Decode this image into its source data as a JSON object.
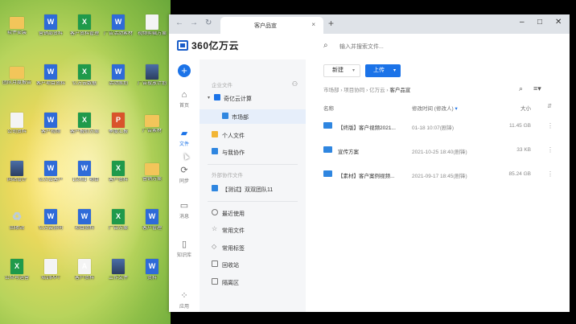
{
  "desktop": {
    "icons": [
      {
        "label": "软件安装",
        "type": "folder",
        "col": 0,
        "row": 0
      },
      {
        "label": "营销部资料",
        "type": "word",
        "col": 1,
        "row": 0
      },
      {
        "label": "客户资料管理",
        "type": "excel",
        "col": 2,
        "row": 0
      },
      {
        "label": "广告活动素材",
        "type": "word",
        "col": 3,
        "row": 0
      },
      {
        "label": "视频剪辑方案",
        "type": "file",
        "col": 4,
        "row": 0
      },
      {
        "label": "团队月度报告",
        "type": "folder",
        "col": 0,
        "row": 1
      },
      {
        "label": "客户项目资料",
        "type": "word",
        "col": 1,
        "row": 1
      },
      {
        "label": "亿万云数据",
        "type": "excel",
        "col": 2,
        "row": 1
      },
      {
        "label": "活动策划",
        "type": "word",
        "col": 3,
        "row": 1
      },
      {
        "label": "广告投放计划",
        "type": "img",
        "col": 4,
        "row": 1
      },
      {
        "label": "公司资料",
        "type": "file",
        "col": 0,
        "row": 2
      },
      {
        "label": "客户视频",
        "type": "word",
        "col": 1,
        "row": 2
      },
      {
        "label": "客户报价方案",
        "type": "excel",
        "col": 2,
        "row": 2
      },
      {
        "label": "季度汇报",
        "type": "ppt",
        "col": 3,
        "row": 2
      },
      {
        "label": "广告素材",
        "type": "folder",
        "col": 4,
        "row": 2
      },
      {
        "label": "网站设计",
        "type": "img",
        "col": 0,
        "row": 3
      },
      {
        "label": "亿万云客户",
        "type": "word",
        "col": 1,
        "row": 3
      },
      {
        "label": "【文档】项目",
        "type": "word",
        "col": 2,
        "row": 3
      },
      {
        "label": "客户资料",
        "type": "excel",
        "col": 3,
        "row": 3
      },
      {
        "label": "营销方案",
        "type": "folder",
        "col": 4,
        "row": 3
      },
      {
        "label": "回收站",
        "type": "recycle",
        "col": 0,
        "row": 4
      },
      {
        "label": "亿万云协同",
        "type": "word",
        "col": 1,
        "row": 4
      },
      {
        "label": "项目资料",
        "type": "word",
        "col": 2,
        "row": 4
      },
      {
        "label": "广告方案",
        "type": "excel",
        "col": 3,
        "row": 4
      },
      {
        "label": "客户管理",
        "type": "word",
        "col": 4,
        "row": 4
      },
      {
        "label": "公众号运营",
        "type": "excel",
        "col": 0,
        "row": 5
      },
      {
        "label": "培训PPT",
        "type": "file",
        "col": 1,
        "row": 5
      },
      {
        "label": "客户资料",
        "type": "pdf",
        "col": 2,
        "row": 5
      },
      {
        "label": "工作文件",
        "type": "img",
        "col": 3,
        "row": 5
      },
      {
        "label": "资料",
        "type": "word",
        "col": 4,
        "row": 5
      }
    ]
  },
  "browser": {
    "tab_title": "客户品宣",
    "tab_close": "×",
    "new_tab": "+",
    "back": "←",
    "forward": "→",
    "reload": "↻"
  },
  "app": {
    "logo_text": "360亿万云",
    "search_placeholder": "输入并搜索文件..."
  },
  "rail": {
    "add": "+",
    "items": [
      {
        "label": "首页",
        "icon": "home-icon",
        "glyph": "⌂",
        "active": false
      },
      {
        "label": "文件",
        "icon": "folder-icon",
        "glyph": "▰",
        "active": true
      },
      {
        "label": "同步",
        "icon": "sync-icon",
        "glyph": "⟳",
        "active": false
      },
      {
        "label": "消息",
        "icon": "message-icon",
        "glyph": "▭",
        "active": false
      },
      {
        "label": "知识库",
        "icon": "book-icon",
        "glyph": "▯",
        "active": false
      },
      {
        "label": "应用",
        "icon": "apps-icon",
        "glyph": "⁘",
        "active": false
      }
    ]
  },
  "nav": {
    "section_enterprise": "企业文件",
    "enterprise_root": "奇亿云计算",
    "enterprise_child": "市场部",
    "personal": "个人文件",
    "shared": "与我协作",
    "section_external": "外部协作文件",
    "external_item": "【测试】双双团队11",
    "recent": "最近使用",
    "common": "常用文件",
    "tags": "常用标签",
    "recycle": "回收站",
    "quarantine": "隔离区"
  },
  "main": {
    "new_label": "新建",
    "upload_label": "上传",
    "breadcrumb": [
      "市场部",
      "项目协同",
      "亿万云",
      "客户品宣"
    ],
    "col_name": "名称",
    "col_time": "修改时间 (修改人)",
    "col_size": "大小",
    "files": [
      {
        "name": "【终版】客户视频2021...",
        "time": "01-18 10:07(剧锋)",
        "size": "11.45 GB"
      },
      {
        "name": "宣传方案",
        "time": "2021-10-25 18:40(剧锋)",
        "size": "33 KB"
      },
      {
        "name": "【素材】客户案例视频...",
        "time": "2021-09-17 18:45(剧锋)",
        "size": "85.24 GB"
      }
    ]
  },
  "colors": {
    "accent": "#1b73e8",
    "brand": "#1b5ec9",
    "excel": "#1f9a4b",
    "word": "#2f6bd8",
    "ppt": "#d9532b",
    "folder": "#f2c55a"
  }
}
